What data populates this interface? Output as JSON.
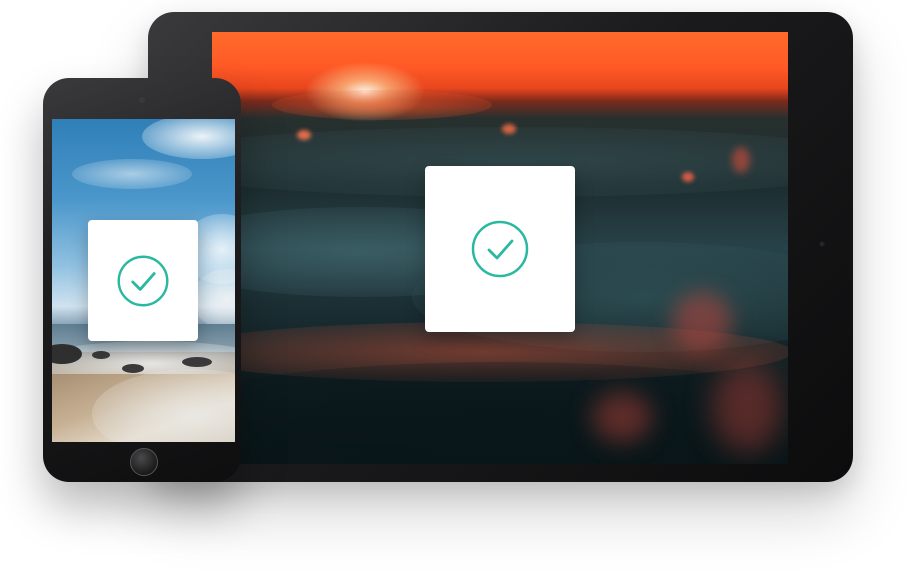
{
  "scene": {
    "devices": [
      "tablet",
      "phone"
    ],
    "tablet": {
      "screen_image": "sunset-ocean-waves",
      "status_icon": "check-circle-icon"
    },
    "phone": {
      "screen_image": "beach-shore-sky",
      "status_icon": "check-circle-icon"
    }
  },
  "colors": {
    "accent": "#2bb8a0",
    "device_frame": "#1b1b1d",
    "card": "#ffffff"
  }
}
